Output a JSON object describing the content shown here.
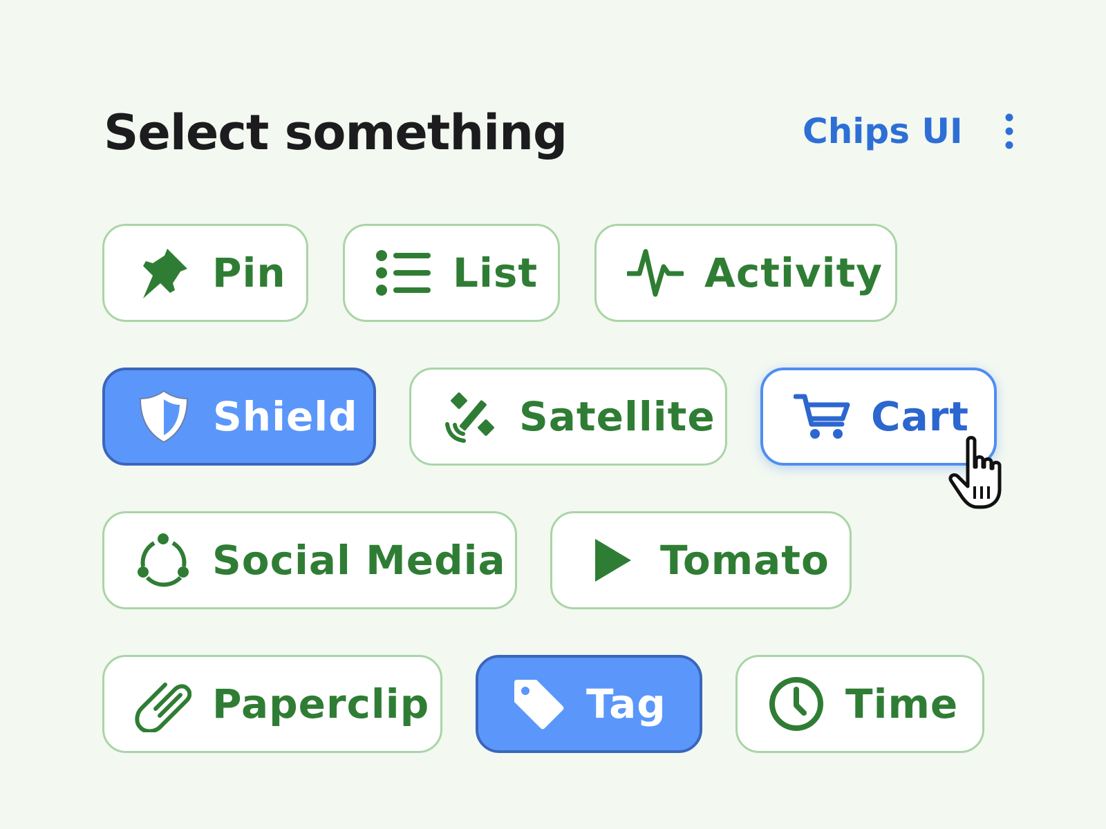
{
  "header": {
    "title": "Select something",
    "brand": "Chips UI",
    "more_icon": "more-vertical-icon"
  },
  "colors": {
    "background": "#f3f8f1",
    "chip_text": "#2f7d34",
    "chip_border": "#a9d5a6",
    "selected_fill": "#5b97fa",
    "selected_border": "#3a66bb",
    "focus_accent": "#2c66cf"
  },
  "chips": [
    {
      "label": "Pin",
      "icon": "pin-icon",
      "state": "default"
    },
    {
      "label": "List",
      "icon": "list-icon",
      "state": "default"
    },
    {
      "label": "Activity",
      "icon": "activity-icon",
      "state": "default"
    },
    {
      "label": "Shield",
      "icon": "shield-icon",
      "state": "selected"
    },
    {
      "label": "Satellite",
      "icon": "satellite-icon",
      "state": "default"
    },
    {
      "label": "Cart",
      "icon": "cart-icon",
      "state": "hover"
    },
    {
      "label": "Social Media",
      "icon": "social-media-icon",
      "state": "default"
    },
    {
      "label": "Tomato",
      "icon": "play-icon",
      "state": "default"
    },
    {
      "label": "Paperclip",
      "icon": "paperclip-icon",
      "state": "default"
    },
    {
      "label": "Tag",
      "icon": "tag-icon",
      "state": "selected"
    },
    {
      "label": "Time",
      "icon": "clock-icon",
      "state": "default"
    }
  ]
}
